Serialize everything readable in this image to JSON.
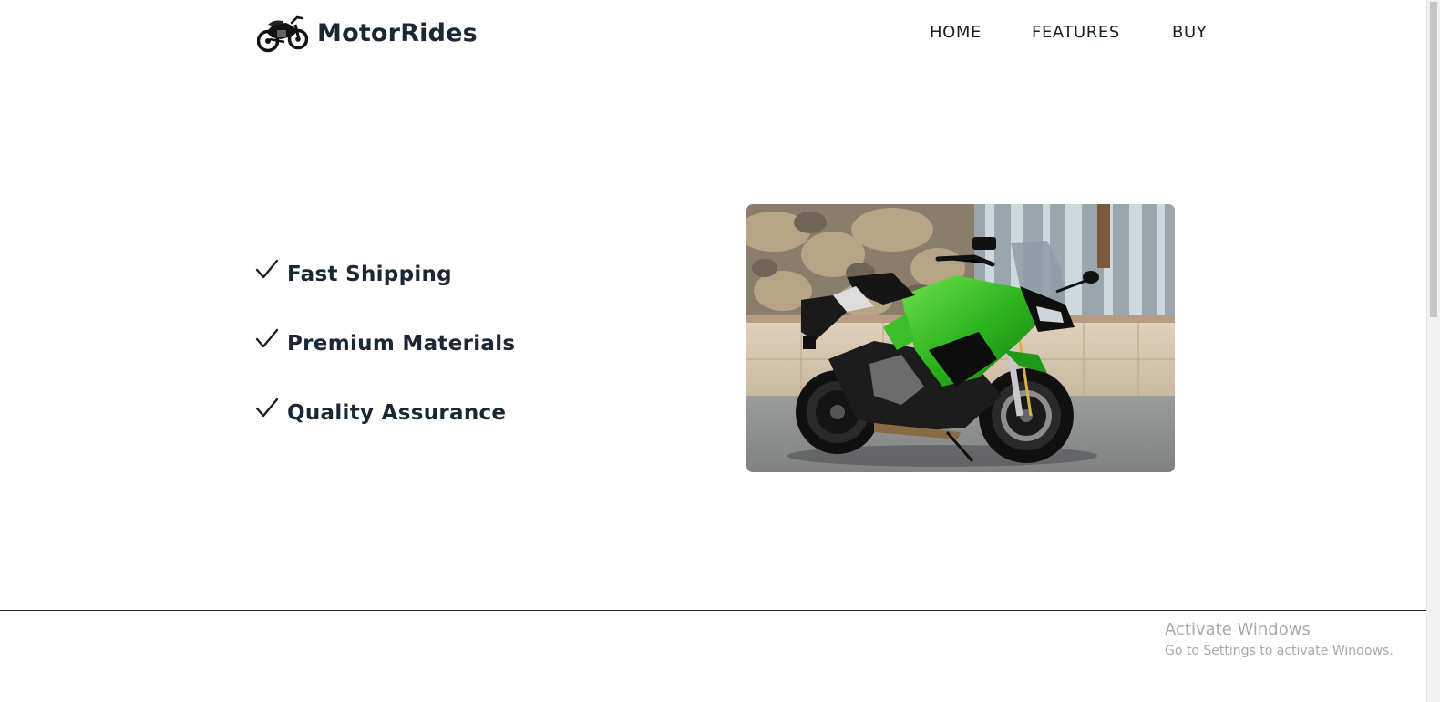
{
  "header": {
    "brand_name": "MotorRides",
    "logo_icon": "motorcycle-icon",
    "nav": [
      {
        "label": "HOME"
      },
      {
        "label": "FEATURES"
      },
      {
        "label": "BUY"
      }
    ]
  },
  "features": {
    "icon": "checkmark-icon",
    "items": [
      {
        "label": "Fast Shipping"
      },
      {
        "label": "Premium Materials"
      },
      {
        "label": "Quality Assurance"
      }
    ]
  },
  "hero_image": {
    "subject": "green-sport-motorcycle-photo"
  },
  "watermark": {
    "title": "Activate Windows",
    "subtitle": "Go to Settings to activate Windows."
  },
  "colors": {
    "text": "#1b2733",
    "border": "#2a2a2a",
    "accent_green": "#3cbf2a",
    "watermark": "#a9a9a9"
  }
}
